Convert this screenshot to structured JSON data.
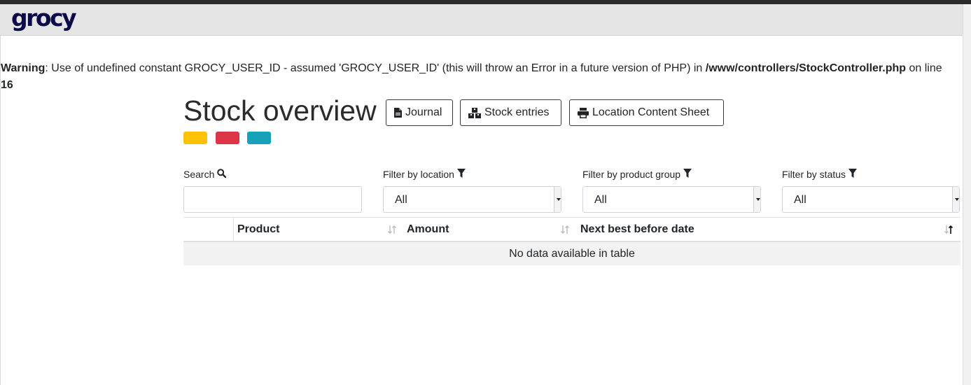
{
  "app": {
    "logo": "grocy"
  },
  "warning": {
    "label": "Warning",
    "message": ": Use of undefined constant GROCY_USER_ID - assumed 'GROCY_USER_ID' (this will throw an Error in a future version of PHP) in ",
    "path": "/www/controllers/StockController.php",
    "line_text": " on line ",
    "line_number": "16"
  },
  "page": {
    "title": "Stock overview",
    "buttons": {
      "journal": "Journal",
      "stock_entries": "Stock entries",
      "location_sheet": "Location Content Sheet"
    },
    "status_colors": [
      "#ffc107",
      "#dc3545",
      "#17a2b8"
    ]
  },
  "filters": {
    "search_label": "Search",
    "search_value": "",
    "location_label": "Filter by location",
    "location_value": "All",
    "group_label": "Filter by product group",
    "group_value": "All",
    "status_label": "Filter by status",
    "status_value": "All"
  },
  "table": {
    "columns": [
      "Product",
      "Amount",
      "Next best before date"
    ],
    "empty_text": "No data available in table"
  },
  "icons": {
    "journal": "file-icon",
    "stock_entries": "boxes-icon",
    "location_sheet": "print-icon",
    "search": "search-icon",
    "filter": "filter-icon"
  }
}
